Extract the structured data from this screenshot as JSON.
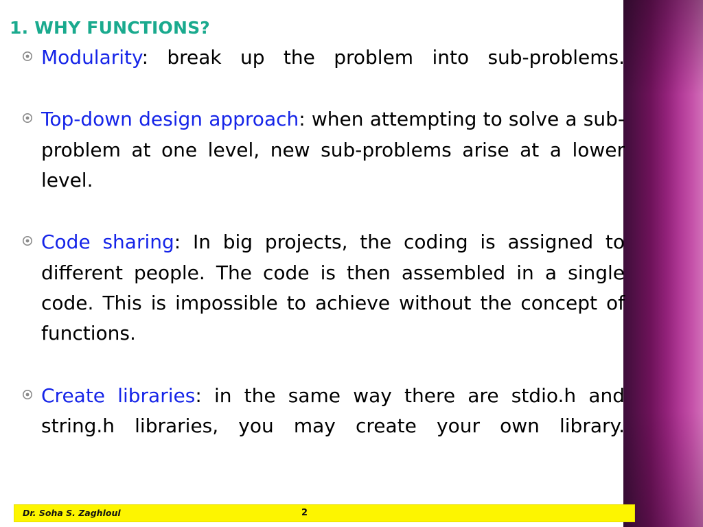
{
  "slide": {
    "title": "1. WHY FUNCTIONS?",
    "title_color": "#1aaa8e",
    "bullet_icon": "ring-bullet-icon",
    "bullets": [
      {
        "lead": "Modularity",
        "rest": ": break up the problem into sub-problems."
      },
      {
        "lead": "Top-down design approach",
        "rest": ": when attempting to solve a sub-problem at one level, new sub-problems arise at a lower level."
      },
      {
        "lead": "Code sharing",
        "rest": ": In big projects, the coding is assigned to different people. The code is then assembled in a single code. This is impossible to achieve without the concept of functions."
      },
      {
        "lead": "Create libraries",
        "rest": ": in the same way there are stdio.h and string.h libraries, you may create your own library."
      }
    ],
    "lead_color": "#1524e8",
    "footer": {
      "author": "Dr. Soha S. Zaghloul",
      "page_number": "2",
      "background_color": "#fdf500"
    },
    "decoration": {
      "right_band_colors": [
        "#3d0d3a",
        "#93227a",
        "#d26fb9"
      ]
    }
  }
}
